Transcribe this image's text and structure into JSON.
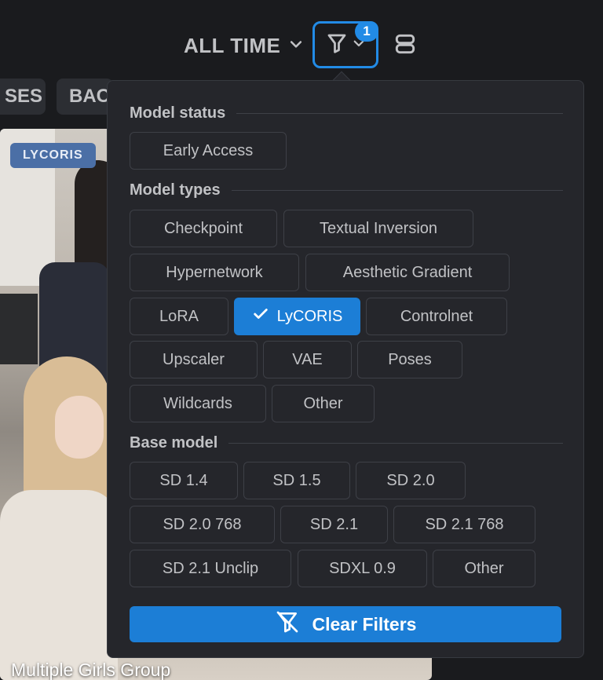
{
  "header": {
    "period_label": "ALL TIME",
    "filter_count": "1"
  },
  "background": {
    "chips": [
      "SES",
      "BAC"
    ],
    "card": {
      "badge": "LYCORIS",
      "title": "Multiple Girls Group"
    }
  },
  "filters": {
    "model_status": {
      "label": "Model status",
      "options": [
        "Early Access"
      ]
    },
    "model_types": {
      "label": "Model types",
      "options": [
        "Checkpoint",
        "Textual Inversion",
        "Hypernetwork",
        "Aesthetic Gradient",
        "LoRA",
        "LyCORIS",
        "Controlnet",
        "Upscaler",
        "VAE",
        "Poses",
        "Wildcards",
        "Other"
      ],
      "selected": "LyCORIS"
    },
    "base_model": {
      "label": "Base model",
      "options": [
        "SD 1.4",
        "SD 1.5",
        "SD 2.0",
        "SD 2.0 768",
        "SD 2.1",
        "SD 2.1 768",
        "SD 2.1 Unclip",
        "SDXL 0.9",
        "Other"
      ]
    },
    "clear_label": "Clear Filters"
  },
  "colors": {
    "accent": "#1c7ed6",
    "background": "#1a1b1e",
    "popover": "#25262b"
  },
  "icons": {
    "period_dropdown": "chevron-down-icon",
    "filter": "filter-icon",
    "layout": "layout-rows-icon",
    "selected_check": "check-icon",
    "clear": "filter-off-icon"
  }
}
